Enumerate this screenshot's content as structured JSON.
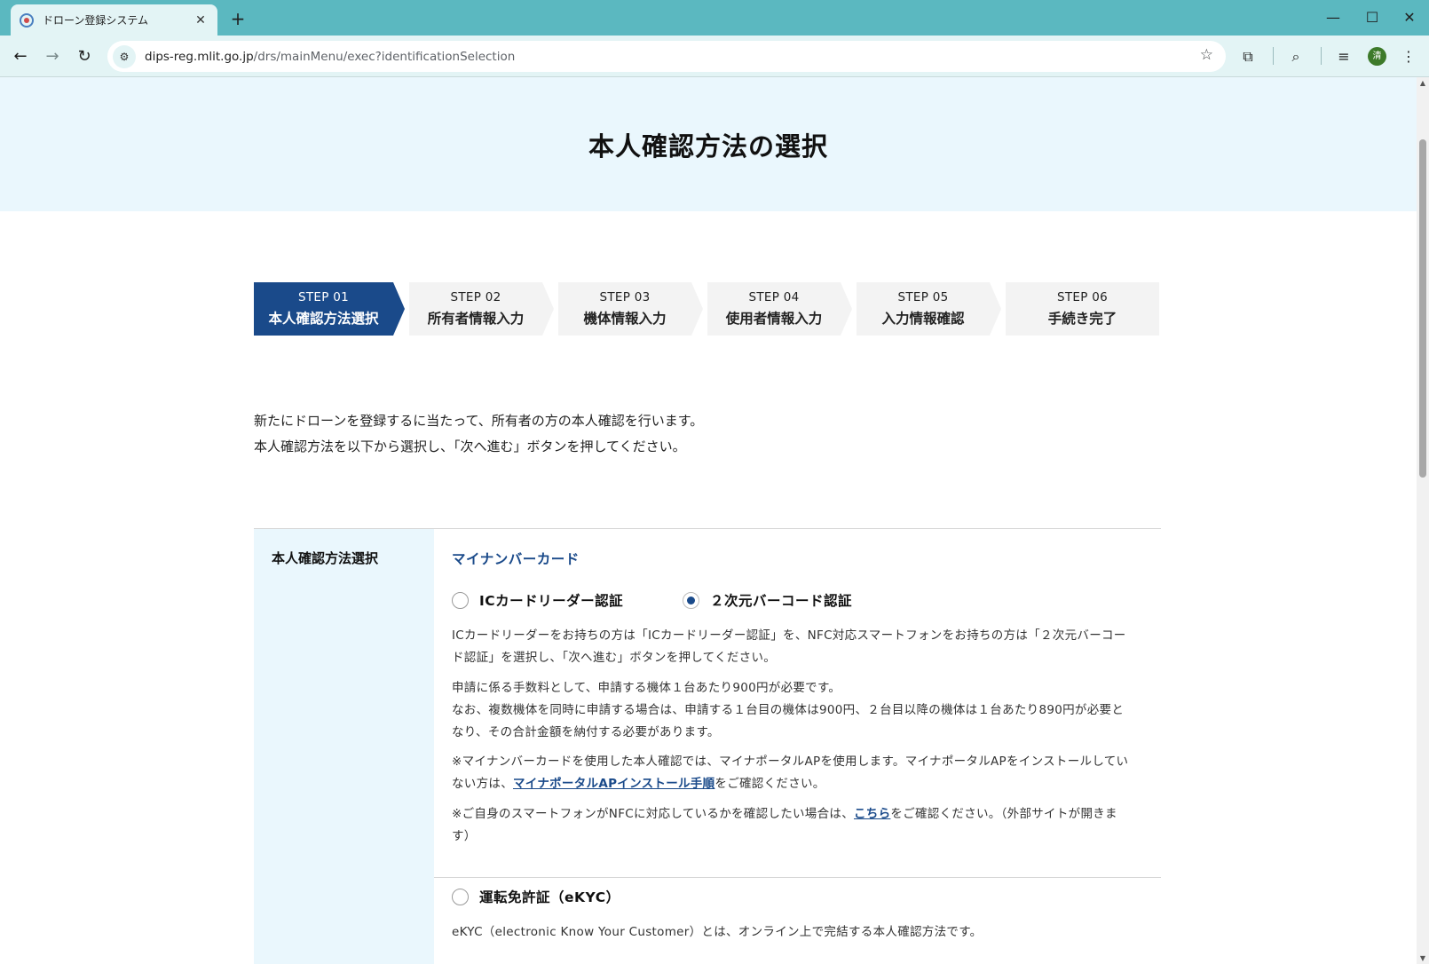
{
  "browser": {
    "tab_title": "ドローン登録システム",
    "tab_close": "✕",
    "new_tab": "+",
    "url_host": "dips-reg.mlit.go.jp",
    "url_path": "/drs/mainMenu/exec?identificationSelection",
    "avatar_initial": "清",
    "icons": [
      "back-icon",
      "forward-icon",
      "reload-icon",
      "site-info-icon",
      "bookmark-star-icon",
      "extensions-icon",
      "search-tab-icon",
      "media-control-icon",
      "menu-icon"
    ]
  },
  "page": {
    "title": "本人確認方法の選択",
    "steps": [
      {
        "label": "STEP 01",
        "name": "本人確認方法選択"
      },
      {
        "label": "STEP 02",
        "name": "所有者情報入力"
      },
      {
        "label": "STEP 03",
        "name": "機体情報入力"
      },
      {
        "label": "STEP 04",
        "name": "使用者情報入力"
      },
      {
        "label": "STEP 05",
        "name": "入力情報確認"
      },
      {
        "label": "STEP 06",
        "name": "手続き完了"
      }
    ],
    "intro_line1": "新たにドローンを登録するに当たって、所有者の方の本人確認を行います。",
    "intro_line2": "本人確認方法を以下から選択し、「次へ進む」ボタンを押してください。",
    "form": {
      "side_label": "本人確認方法選択",
      "section_title": "マイナンバーカード",
      "option_ic": "ICカードリーダー認証",
      "option_barcode": "２次元バーコード認証",
      "selected": "２次元バーコード認証",
      "p1": "ICカードリーダーをお持ちの方は「ICカードリーダー認証」を、NFC対応スマートフォンをお持ちの方は「２次元バーコード認証」を選択し、「次へ進む」ボタンを押してください。",
      "p2_line1": "申請に係る手数料として、申請する機体１台あたり900円が必要です。",
      "p2_line2": "なお、複数機体を同時に申請する場合は、申請する１台目の機体は900円、２台目以降の機体は１台あたり890円が必要となり、その合計金額を納付する必要があります。",
      "p3_before": "※マイナンバーカードを使用した本人確認では、マイナポータルAPを使用します。マイナポータルAPをインストールしていない方は、",
      "p3_link": "マイナポータルAPインストール手順",
      "p3_after": "をご確認ください。",
      "p4_before": "※ご自身のスマートフォンがNFCに対応しているかを確認したい場合は、",
      "p4_link": "こちら",
      "p4_after": "をご確認ください。（外部サイトが開きます）",
      "option_ekyc": "運転免許証（eKYC）",
      "p5": "eKYC（electronic Know Your Customer）とは、オンライン上で完結する本人確認方法です。"
    }
  },
  "colors": {
    "chrome": "#5bb8c0",
    "toolbar": "#e3f4f5",
    "hero_bg": "#eaf7fd",
    "accent": "#1a4a8a",
    "step_inactive": "#f3f3f3"
  }
}
